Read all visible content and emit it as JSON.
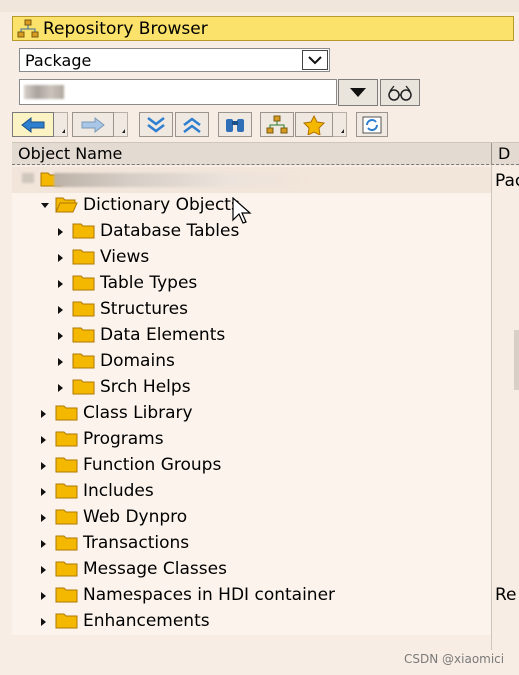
{
  "panel": {
    "title": "Repository Browser"
  },
  "object_type": {
    "selected": "Package"
  },
  "search": {
    "value": ""
  },
  "header": {
    "col1": "Object Name",
    "col2": "D"
  },
  "root": {
    "label": "",
    "col2": "Pac"
  },
  "tree": [
    {
      "label": "Dictionary Objects",
      "level": 1,
      "expanded": true,
      "col2": ""
    },
    {
      "label": "Database Tables",
      "level": 2,
      "expanded": false,
      "col2": ""
    },
    {
      "label": "Views",
      "level": 2,
      "expanded": false,
      "col2": ""
    },
    {
      "label": "Table Types",
      "level": 2,
      "expanded": false,
      "col2": ""
    },
    {
      "label": "Structures",
      "level": 2,
      "expanded": false,
      "col2": ""
    },
    {
      "label": "Data Elements",
      "level": 2,
      "expanded": false,
      "col2": ""
    },
    {
      "label": "Domains",
      "level": 2,
      "expanded": false,
      "col2": ""
    },
    {
      "label": "Srch Helps",
      "level": 2,
      "expanded": false,
      "col2": ""
    },
    {
      "label": "Class Library",
      "level": 1,
      "expanded": false,
      "col2": ""
    },
    {
      "label": "Programs",
      "level": 1,
      "expanded": false,
      "col2": ""
    },
    {
      "label": "Function Groups",
      "level": 1,
      "expanded": false,
      "col2": ""
    },
    {
      "label": "Includes",
      "level": 1,
      "expanded": false,
      "col2": ""
    },
    {
      "label": "Web Dynpro",
      "level": 1,
      "expanded": false,
      "col2": ""
    },
    {
      "label": "Transactions",
      "level": 1,
      "expanded": false,
      "col2": ""
    },
    {
      "label": "Message Classes",
      "level": 1,
      "expanded": false,
      "col2": ""
    },
    {
      "label": "Namespaces in HDI container",
      "level": 1,
      "expanded": false,
      "col2": "Re"
    },
    {
      "label": "Enhancements",
      "level": 1,
      "expanded": false,
      "col2": ""
    }
  ],
  "watermark": "CSDN @xiaomici",
  "colors": {
    "title_bg": "#fbe26a",
    "folder": "#f5b800",
    "row_bg": "#fbf3ec"
  }
}
